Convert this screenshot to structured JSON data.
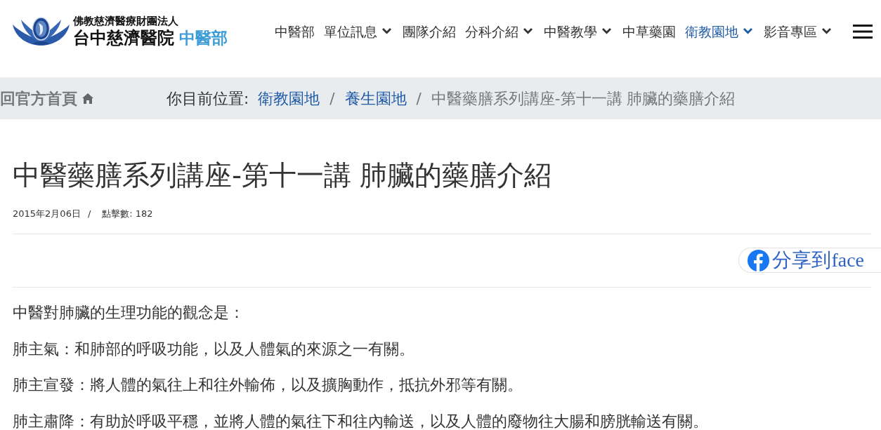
{
  "header": {
    "logo": {
      "org": "佛教慈濟醫療財團法人",
      "name": "台中慈濟醫院",
      "dept": "中醫部"
    },
    "nav": [
      {
        "label": "中醫部",
        "dropdown": false,
        "selected": false
      },
      {
        "label": "單位訊息",
        "dropdown": true,
        "selected": false
      },
      {
        "label": "團隊介紹",
        "dropdown": false,
        "selected": false
      },
      {
        "label": "分科介紹",
        "dropdown": true,
        "selected": false
      },
      {
        "label": "中醫教學",
        "dropdown": true,
        "selected": false
      },
      {
        "label": "中草藥園",
        "dropdown": false,
        "selected": false
      },
      {
        "label": "衛教園地",
        "dropdown": true,
        "selected": true
      },
      {
        "label": "影音專區",
        "dropdown": true,
        "selected": false
      }
    ]
  },
  "breadcrumb": {
    "home_link": "回官方首頁",
    "prefix": "你目前位置:",
    "crumbs": [
      {
        "kind": "link",
        "text": "衛教園地"
      },
      {
        "kind": "separator",
        "text": "/"
      },
      {
        "kind": "link",
        "text": "養生園地"
      },
      {
        "kind": "separator",
        "text": "/"
      },
      {
        "kind": "current",
        "text": "中醫藥膳系列講座-第十一講 肺臟的藥膳介紹"
      }
    ]
  },
  "article": {
    "title": "中醫藥膳系列講座-第十一講 肺臟的藥膳介紹",
    "meta": {
      "date": "2015年2月06日",
      "separator": "/",
      "hits": "點擊數: 182"
    },
    "share": {
      "label": "分享到face"
    },
    "paragraphs": [
      "中醫對肺臟的生理功能的觀念是：",
      "肺主氣：和肺部的呼吸功能，以及人體氣的來源之一有關。",
      "肺主宣發：將人體的氣往上和往外輸佈，以及擴胸動作，抵抗外邪等有關。",
      "肺主肅降：有助於呼吸平穩，並將人體的氣往下和往內輸送，以及人體的廢物往大腸和膀胱輸送有關。"
    ]
  }
}
